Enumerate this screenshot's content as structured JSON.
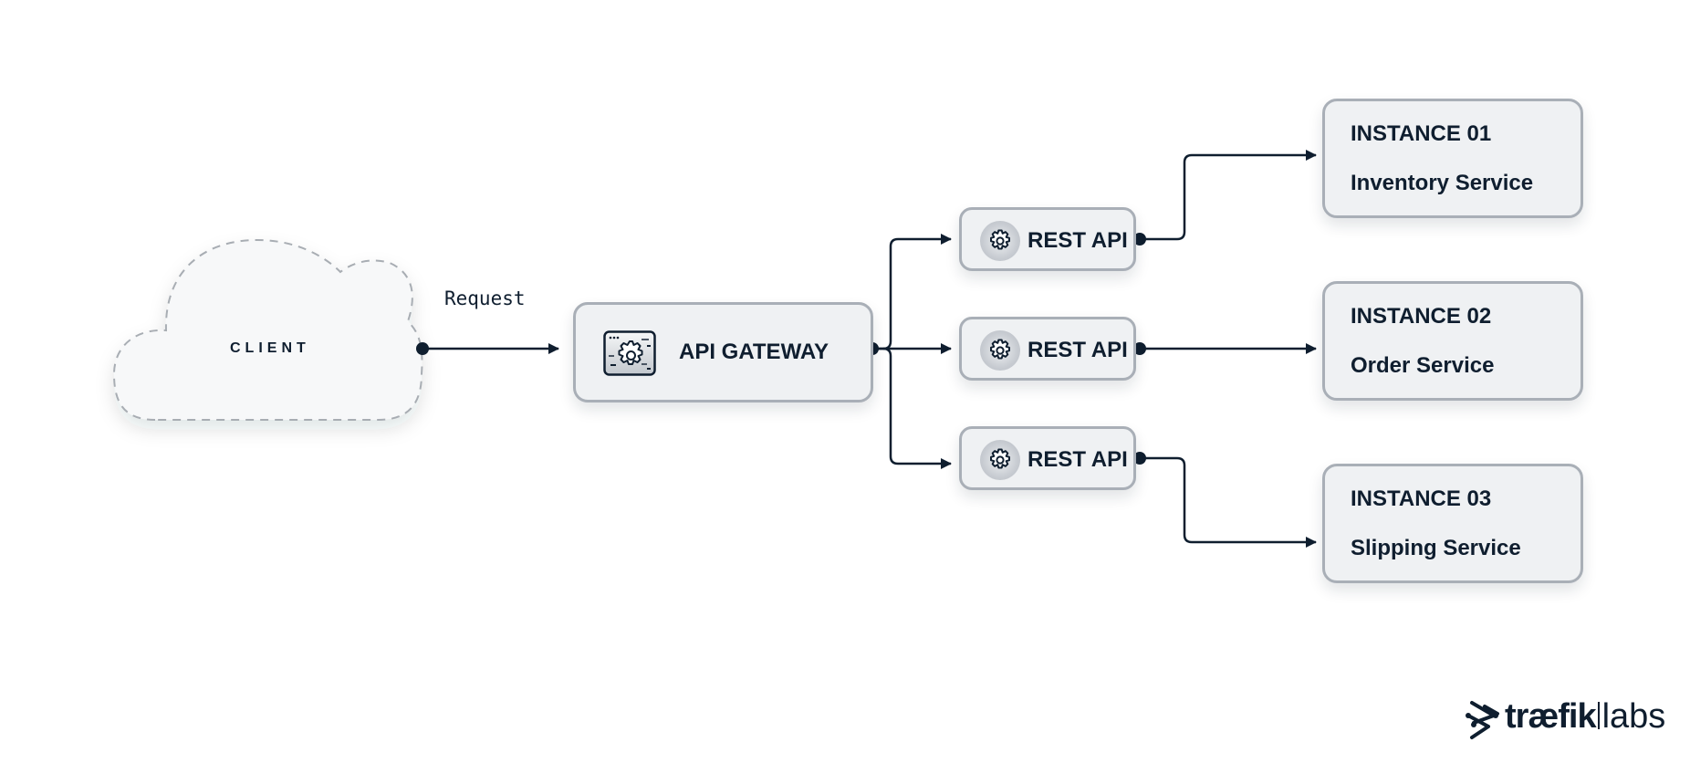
{
  "diagram": {
    "client": {
      "label": "CLIENT"
    },
    "request_edge": {
      "label": "Request"
    },
    "gateway": {
      "label": "API GATEWAY",
      "icon": "gear-window-icon"
    },
    "rest_apis": [
      {
        "label": "REST API",
        "icon": "gear-icon"
      },
      {
        "label": "REST API",
        "icon": "gear-icon"
      },
      {
        "label": "REST API",
        "icon": "gear-icon"
      }
    ],
    "instances": [
      {
        "title": "INSTANCE 01",
        "service": "Inventory Service"
      },
      {
        "title": "INSTANCE 02",
        "service": "Order Service"
      },
      {
        "title": "INSTANCE 03",
        "service": "Slipping Service"
      }
    ],
    "edges": [
      {
        "from": "client",
        "to": "gateway",
        "label": "Request"
      },
      {
        "from": "gateway",
        "to": "rest_api_1"
      },
      {
        "from": "gateway",
        "to": "rest_api_2"
      },
      {
        "from": "gateway",
        "to": "rest_api_3"
      },
      {
        "from": "rest_api_1",
        "to": "instance_01"
      },
      {
        "from": "rest_api_2",
        "to": "instance_02"
      },
      {
        "from": "rest_api_3",
        "to": "instance_03"
      }
    ]
  },
  "brand": {
    "name_bold": "træfik",
    "name_light": "labs"
  },
  "colors": {
    "ink": "#0f1e2f",
    "box_fill": "#eff1f3",
    "box_border": "#a9afb7",
    "cloud_fill": "#f7f8f9",
    "cloud_dash": "#a8adb3"
  }
}
